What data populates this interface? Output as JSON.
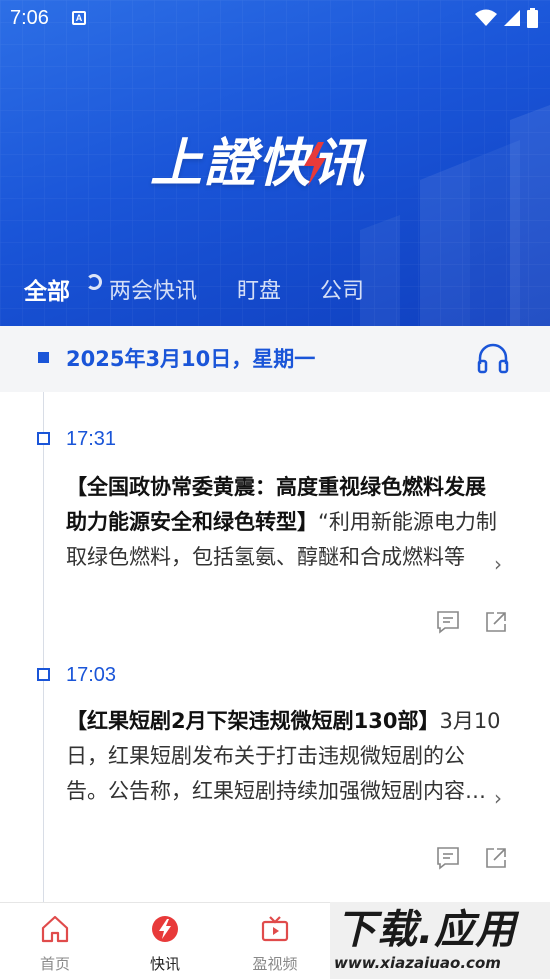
{
  "status_bar": {
    "time": "7:06",
    "notification_icon": "A"
  },
  "header": {
    "logo_text_1": "上證",
    "logo_text_2": "快",
    "logo_text_3": "讯"
  },
  "tabs": [
    {
      "label": "全部",
      "active": true
    },
    {
      "label": "两会快讯",
      "active": false
    },
    {
      "label": "盯盘",
      "active": false
    },
    {
      "label": "公司",
      "active": false
    }
  ],
  "date_bar": {
    "date": "2025年3月10日，星期一",
    "audio_icon": "headphones-icon"
  },
  "news": [
    {
      "time": "17:31",
      "headline": "【全国政协常委黄震：高度重视绿色燃料发展 助力能源安全和绿色转型】",
      "body": "“利用新能源电力制取绿色燃料，包括氢氨、醇醚和合成燃料等"
    },
    {
      "time": "17:03",
      "headline": "【红果短剧2月下架违规微短剧130部】",
      "body": "3月10日，红果短剧发布关于打击违规微短剧的公告。公告称，红果短剧持续加强微短剧内容管理"
    }
  ],
  "bottom_nav": [
    {
      "label": "首页",
      "icon": "home-icon",
      "active": false
    },
    {
      "label": "快讯",
      "icon": "flash-icon",
      "active": true
    },
    {
      "label": "盈视频",
      "icon": "tv-icon",
      "active": false
    }
  ],
  "watermark": {
    "title": "下载.应用",
    "url": "www.xiazaiuao.com"
  },
  "colors": {
    "brand_blue": "#1a55d8",
    "accent_red": "#e83a3a"
  }
}
